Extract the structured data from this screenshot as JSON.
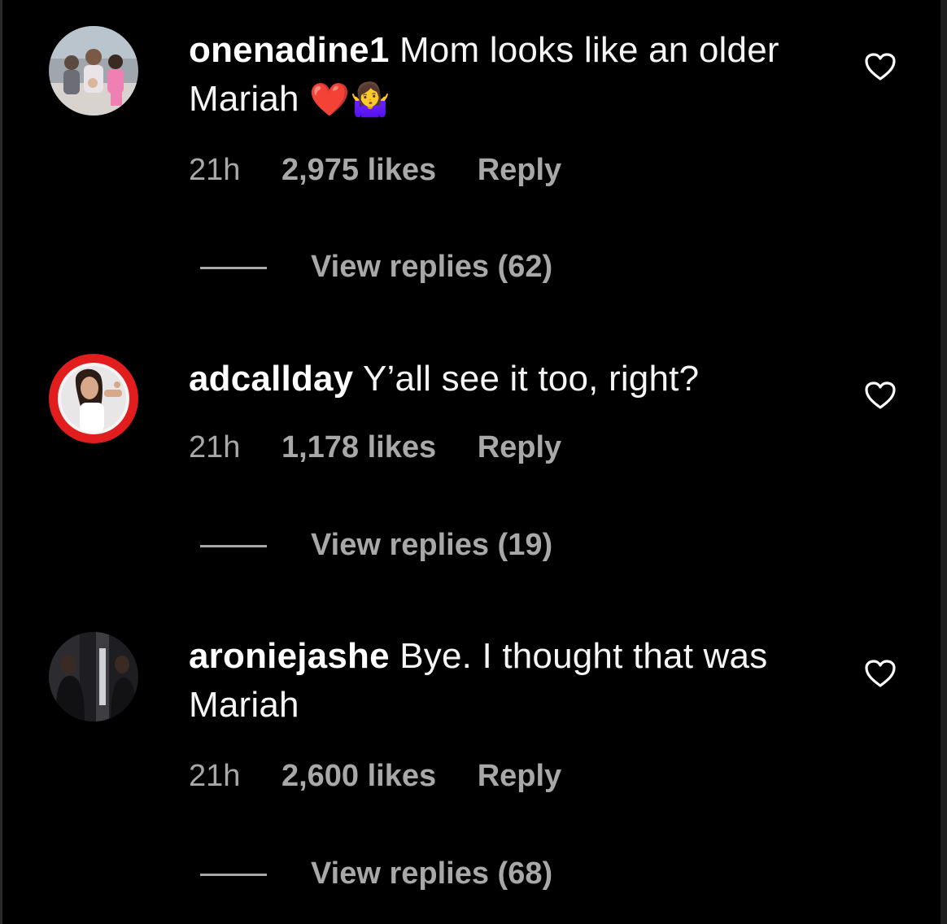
{
  "comments": [
    {
      "username": "onenadine1",
      "text": "Mom looks like an older Mariah",
      "emoji": "❤️🤷‍♀️",
      "time": "21h",
      "likes": "2,975 likes",
      "reply_label": "Reply",
      "view_replies": "View replies (62)"
    },
    {
      "username": "adcallday",
      "text": "Y’all see it too, right?",
      "emoji": "",
      "time": "21h",
      "likes": "1,178 likes",
      "reply_label": "Reply",
      "view_replies": "View replies (19)"
    },
    {
      "username": "aroniejashe",
      "text": "Bye. I thought that was Mariah",
      "emoji": "",
      "time": "21h",
      "likes": "2,600 likes",
      "reply_label": "Reply",
      "view_replies": "View replies (68)"
    }
  ],
  "icons": {
    "like": "heart-outline-icon"
  },
  "colors": {
    "background": "#000000",
    "primary_text": "#ffffff",
    "secondary_text": "#a8a8a8"
  }
}
